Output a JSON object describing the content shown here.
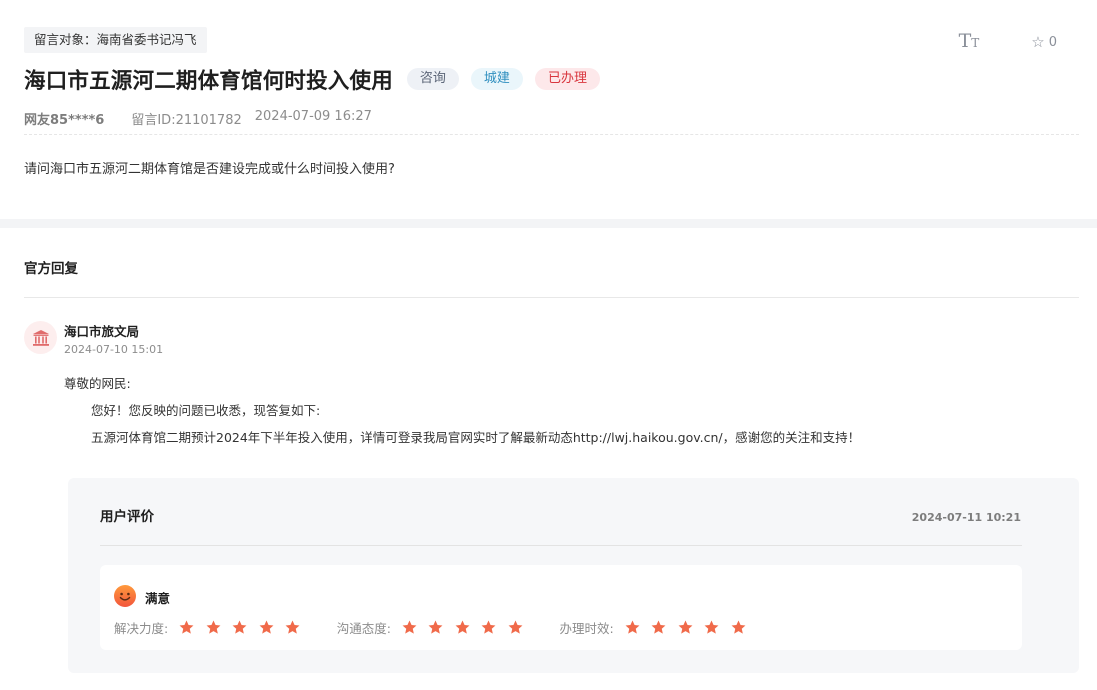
{
  "message": {
    "target_label": "留言对象：海南省委书记冯飞",
    "title": "海口市五源河二期体育馆何时投入使用",
    "badges": [
      "咨询",
      "城建",
      "已办理"
    ],
    "user": "网友85****6",
    "message_id": "留言ID:21101782",
    "datetime": "2024-07-09 16:27",
    "question": "请问海口市五源河二期体育馆是否建设完成或什么时间投入使用?",
    "font_tool": {
      "big": "T",
      "small": "T"
    },
    "favorite_count": "0"
  },
  "reply": {
    "section_title": "官方回复",
    "org_icon": "government-building-icon",
    "org_name": "海口市旅文局",
    "org_time": "2024-07-10 15:01",
    "salutation": "尊敬的网民:",
    "line1": "您好！您反映的问题已收悉，现答复如下:",
    "line2": "五源河体育馆二期预计2024年下半年投入使用，详情可登录我局官网实时了解最新动态http://lwj.haikou.gov.cn/，感谢您的关注和支持！"
  },
  "evaluation": {
    "title": "用户评价",
    "time": "2024-07-11 10:21",
    "satisfaction": "满意",
    "satisfaction_icon": "smiley-face-icon",
    "ratings": [
      {
        "label": "解决力度:",
        "stars": 5
      },
      {
        "label": "沟通态度:",
        "stars": 5
      },
      {
        "label": "办理时效:",
        "stars": 5
      }
    ]
  },
  "colors": {
    "accent_red": "#d9363e",
    "star": "#f06a4a",
    "badge_blue_text": "#2f8fbf",
    "gray_text": "#8c8c8c"
  }
}
